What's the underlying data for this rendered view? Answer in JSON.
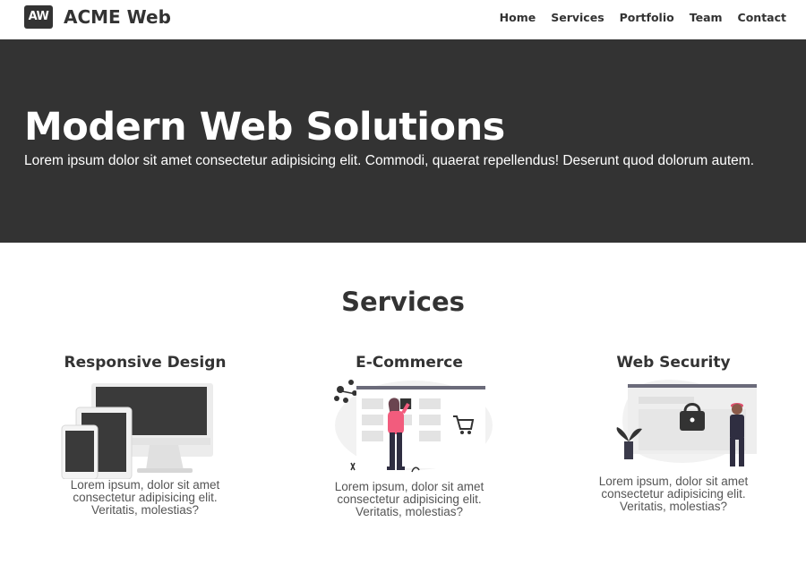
{
  "header": {
    "logo_text": "AW",
    "brand": "ACME Web",
    "nav": [
      "Home",
      "Services",
      "Portfolio",
      "Team",
      "Contact"
    ]
  },
  "hero": {
    "title": "Modern Web Solutions",
    "subtitle": "Lorem ipsum dolor sit amet consectetur adipisicing elit. Commodi, quaerat repellendus! Deserunt quod dolorum autem."
  },
  "services": {
    "title": "Services",
    "items": [
      {
        "title": "Responsive Design",
        "text": "Lorem ipsum, dolor sit amet consectetur adipisicing elit. Veritatis, molestias?",
        "icon": "responsive-devices-illustration"
      },
      {
        "title": "E-Commerce",
        "text": "Lorem ipsum, dolor sit amet consectetur adipisicing elit. Veritatis, molestias?",
        "icon": "ecommerce-shopping-illustration"
      },
      {
        "title": "Web Security",
        "text": "Lorem ipsum, dolor sit amet consectetur adipisicing elit. Veritatis, molestias?",
        "icon": "web-security-lock-illustration"
      }
    ]
  },
  "colors": {
    "dark": "#333333",
    "accent": "#f25c7d",
    "light_gray": "#e6e6e6"
  }
}
